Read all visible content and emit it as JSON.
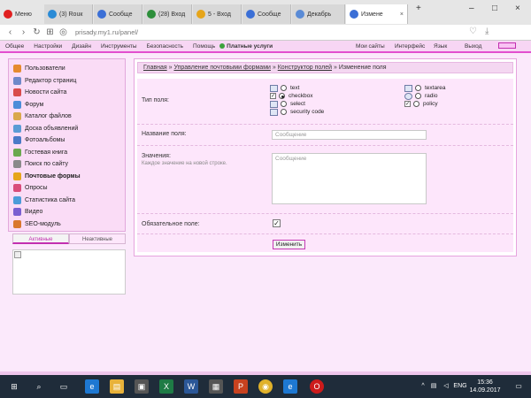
{
  "browser": {
    "menu_label": "Меню",
    "tabs": [
      {
        "label": "(3) Rouк",
        "color": "#2a8bd6"
      },
      {
        "label": "Сообщe",
        "color": "#3b6fd6"
      },
      {
        "label": "(28) Вход",
        "color": "#2d8f3b"
      },
      {
        "label": "5 - Вход",
        "color": "#e6a51b"
      },
      {
        "label": "Сообщe",
        "color": "#3b6fd6"
      },
      {
        "label": "Декабрь",
        "color": "#5a8bd6"
      },
      {
        "label": "Изменe",
        "color": "#3b6fd6"
      }
    ],
    "new_tab": "+",
    "url": "prisady.my1.ru/panel/"
  },
  "site_top": {
    "links": [
      "Общее",
      "Настройки",
      "Дизайн",
      "Инструменты",
      "Безопасность",
      "Помощь"
    ],
    "paid": "Платные услуги",
    "right_links": [
      "Мои сайты",
      "Интерфейс",
      "Язык",
      "Выход"
    ]
  },
  "sidebar": {
    "items": [
      {
        "label": "Пользователи",
        "color": "#e58a2e"
      },
      {
        "label": "Редактор страниц",
        "color": "#6f88c9"
      },
      {
        "label": "Новости сайта",
        "color": "#d94b4b"
      },
      {
        "label": "Форум",
        "color": "#4b8dd9"
      },
      {
        "label": "Каталог файлов",
        "color": "#d9a84b"
      },
      {
        "label": "Доска объявлений",
        "color": "#5b9bd5"
      },
      {
        "label": "Фотоальбомы",
        "color": "#4a79c7"
      },
      {
        "label": "Гостевая книга",
        "color": "#6aa84f"
      },
      {
        "label": "Поиск по сайту",
        "color": "#8a8a8a"
      },
      {
        "label": "Почтовые формы",
        "color": "#e6a51b"
      },
      {
        "label": "Опросы",
        "color": "#d94b7a"
      },
      {
        "label": "Статистика сайта",
        "color": "#4b9bd9"
      },
      {
        "label": "Видео",
        "color": "#7a5fd1"
      },
      {
        "label": "SEO-модуль",
        "color": "#d9772e"
      }
    ],
    "tab_active": "Активные",
    "tab_inactive": "Неактивные"
  },
  "breadcrumb": {
    "home": "Главная",
    "sep": "»",
    "mail": "Управление почтовыми формами",
    "builder": "Конструктор полей",
    "current": "Изменение поля"
  },
  "form": {
    "type_label": "Тип поля:",
    "types": {
      "text": "text",
      "checkbox": "checkbox",
      "select": "select",
      "security": "security code",
      "textarea": "textarea",
      "radio": "radio",
      "policy": "policy"
    },
    "name_label": "Название поля:",
    "name_value": "Сообщение",
    "values_label": "Значения:",
    "values_hint": "Каждое значение на новой строке.",
    "values_placeholder": "Сообщение",
    "required_label": "Обязательное поле:",
    "required_mark": "✓",
    "check_mark": "✓",
    "submit": "Изменить"
  },
  "taskbar": {
    "lang": "ENG",
    "time": "15:36",
    "date": "14.09.2017"
  }
}
